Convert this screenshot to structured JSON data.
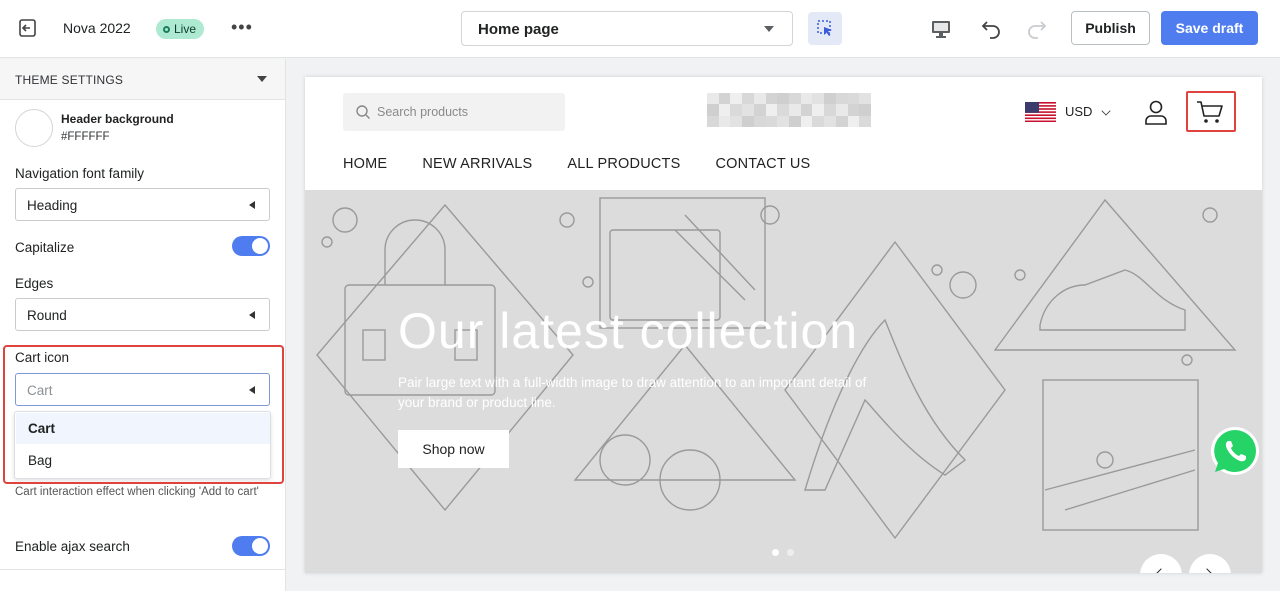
{
  "topbar": {
    "theme_name": "Nova 2022",
    "status_badge": "Live",
    "more_label": "•••",
    "page_select": "Home page",
    "publish_label": "Publish",
    "save_label": "Save draft"
  },
  "sidebar": {
    "section_title": "THEME SETTINGS",
    "header_background": {
      "label": "Header background",
      "value": "#FFFFFF"
    },
    "nav_font": {
      "label": "Navigation font family",
      "value": "Heading"
    },
    "capitalize": {
      "label": "Capitalize",
      "on": true
    },
    "edges": {
      "label": "Edges",
      "value": "Round"
    },
    "cart_icon": {
      "label": "Cart icon",
      "value": "Cart",
      "options": [
        "Cart",
        "Bag"
      ]
    },
    "cart_help": "Cart interaction effect when clicking 'Add to cart'",
    "ajax_search": {
      "label": "Enable ajax search",
      "on": true
    }
  },
  "preview": {
    "search_placeholder": "Search products",
    "currency": "USD",
    "nav": [
      "HOME",
      "NEW ARRIVALS",
      "ALL PRODUCTS",
      "CONTACT US"
    ],
    "hero": {
      "title": "Our latest collection",
      "subtitle": "Pair large text with a full-width image to draw attention to an important detail of your brand or product line.",
      "button": "Shop now"
    }
  },
  "colors": {
    "accent": "#4f7df0",
    "live_badge": "#aee9d1",
    "highlight_red": "#e0433d",
    "whatsapp": "#25d366"
  }
}
